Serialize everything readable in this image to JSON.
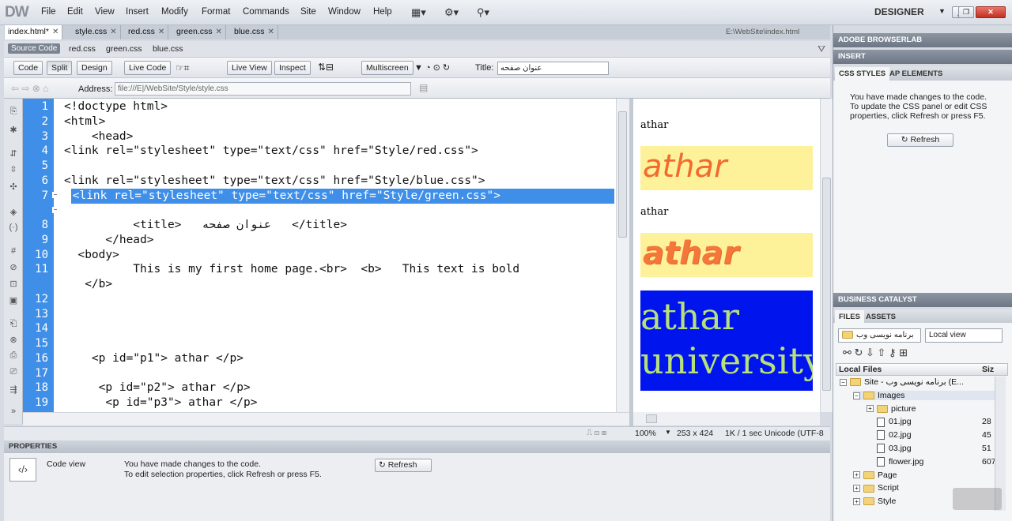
{
  "app": {
    "logo": "DW",
    "workspace": "DESIGNER"
  },
  "menu": [
    "File",
    "Edit",
    "View",
    "Insert",
    "Modify",
    "Format",
    "Commands",
    "Site",
    "Window",
    "Help"
  ],
  "tabs": [
    {
      "label": "index.html*",
      "active": true
    },
    {
      "label": "style.css"
    },
    {
      "label": "red.css"
    },
    {
      "label": "green.css"
    },
    {
      "label": "blue.css"
    }
  ],
  "file_path": "E:\\WebSite\\index.html",
  "related_files": {
    "source": "Source Code",
    "files": [
      "red.css",
      "green.css",
      "blue.css"
    ]
  },
  "doc_toolbar": {
    "code": "Code",
    "split": "Split",
    "design": "Design",
    "live_code": "Live Code",
    "live_view": "Live View",
    "inspect": "Inspect",
    "multiscreen": "Multiscreen",
    "title_label": "Title:",
    "title_value": "عنوان صفحه"
  },
  "address": {
    "label": "Address:",
    "value": "file:///E|/WebSite/Style/style.css"
  },
  "code_lines": [
    {
      "n": "1",
      "t": "<!doctype html>"
    },
    {
      "n": "2",
      "t": "<html>"
    },
    {
      "n": "3",
      "t": "    <head>"
    },
    {
      "n": "4",
      "t": "<link rel=\"stylesheet\" type=\"text/css\" href=\"Style/red.css\">"
    },
    {
      "n": "5",
      "t": ""
    },
    {
      "n": "6",
      "t": "<link rel=\"stylesheet\" type=\"text/css\" href=\"Style/blue.css\">"
    },
    {
      "n": "7",
      "t": " <link rel=\"stylesheet\" type=\"text/css\" href=\"Style/green.css\">"
    },
    {
      "n": "",
      "t": ""
    },
    {
      "n": "8",
      "t": "          <title>   عنوان صفحه   </title>"
    },
    {
      "n": "9",
      "t": "      </head>"
    },
    {
      "n": "10",
      "t": "  <body>"
    },
    {
      "n": "11",
      "t": "          This is my first home page.<br>  <b>   This text is bold"
    },
    {
      "n": "",
      "t": "   </b>"
    },
    {
      "n": "12",
      "t": ""
    },
    {
      "n": "13",
      "t": ""
    },
    {
      "n": "14",
      "t": ""
    },
    {
      "n": "15",
      "t": ""
    },
    {
      "n": "16",
      "t": "    <p id=\"p1\"> athar </p>"
    },
    {
      "n": "17",
      "t": ""
    },
    {
      "n": "18",
      "t": "     <p id=\"p2\"> athar </p>"
    },
    {
      "n": "19",
      "t": "      <p id=\"p3\"> athar </p>"
    }
  ],
  "design_view": {
    "p1": "athar",
    "p1_styled": "athar",
    "p2": "athar",
    "p2_styled": "athar",
    "p3_line1": "athar",
    "p3_line2": "university"
  },
  "status_bar": {
    "zoom": "100%",
    "size": "253 x 424",
    "weight": "1K / 1 sec",
    "encoding": "Unicode (UTF-8"
  },
  "properties": {
    "title": "PROPERTIES",
    "view": "Code view",
    "msg1": "You have made changes to the code.",
    "msg2": "To edit selection properties, click Refresh or press F5.",
    "refresh": "Refresh"
  },
  "panels": {
    "browserlab": "ADOBE BROWSERLAB",
    "insert": "INSERT",
    "css_tab": "CSS STYLES",
    "ap_tab": "AP ELEMENTS",
    "css_msg": "You have made changes to the code. To update the CSS panel or edit CSS properties, click Refresh or press F5.",
    "css_refresh": "Refresh",
    "business": "BUSINESS CATALYST",
    "files_tab": "FILES",
    "assets_tab": "ASSETS",
    "site_select": "برنامه نویسی وب",
    "view_select": "Local view",
    "local_files": "Local Files",
    "size_col": "Siz"
  },
  "file_tree": [
    {
      "label": "Site - برنامه نویسی وب (E...",
      "size": "",
      "type": "folder",
      "depth": 0,
      "pm": "−"
    },
    {
      "label": "Images",
      "size": "",
      "type": "folder",
      "depth": 1,
      "pm": "−",
      "selected": true
    },
    {
      "label": "picture",
      "size": "",
      "type": "folder",
      "depth": 2,
      "pm": "+"
    },
    {
      "label": "01.jpg",
      "size": "28",
      "type": "file",
      "depth": 2
    },
    {
      "label": "02.jpg",
      "size": "45",
      "type": "file",
      "depth": 2
    },
    {
      "label": "03.jpg",
      "size": "51",
      "type": "file",
      "depth": 2
    },
    {
      "label": "flower.jpg",
      "size": "607",
      "type": "file",
      "depth": 2
    },
    {
      "label": "Page",
      "size": "",
      "type": "folder",
      "depth": 1,
      "pm": "+"
    },
    {
      "label": "Script",
      "size": "",
      "type": "folder",
      "depth": 1,
      "pm": "+"
    },
    {
      "label": "Style",
      "size": "",
      "type": "folder",
      "depth": 1,
      "pm": "+"
    }
  ]
}
